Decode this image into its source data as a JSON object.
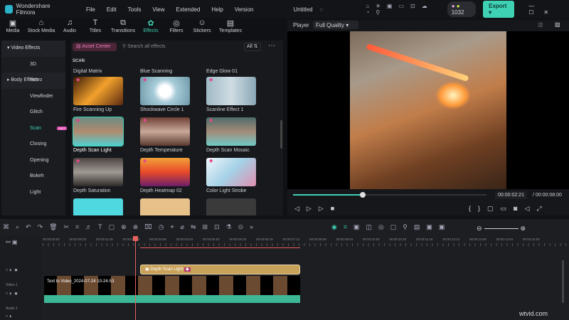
{
  "titlebar": {
    "app": "Wondershare Filmora",
    "menu": [
      "File",
      "Edit",
      "Tools",
      "View",
      "Extended",
      "Help",
      "Version"
    ],
    "project": "Untitled",
    "credits": "1032",
    "export": "Export"
  },
  "toolbar": [
    {
      "label": "Media",
      "icon": "▣"
    },
    {
      "label": "Stock Media",
      "icon": "⌂"
    },
    {
      "label": "Audio",
      "icon": "♫"
    },
    {
      "label": "Titles",
      "icon": "T"
    },
    {
      "label": "Transitions",
      "icon": "⧉"
    },
    {
      "label": "Effects",
      "icon": "✿"
    },
    {
      "label": "Filters",
      "icon": "◎"
    },
    {
      "label": "Stickers",
      "icon": "☺"
    },
    {
      "label": "Templates",
      "icon": "▤"
    }
  ],
  "sidebar": {
    "video_effects": "Video Effects",
    "items": [
      "3D",
      "Retro",
      "Viewfinder",
      "Glitch",
      "Scan",
      "Closing",
      "Opening",
      "Bokeh",
      "Light"
    ],
    "badge": "HOT",
    "body_effects": "Body Effects"
  },
  "effects": {
    "asset_center": "Asset Center",
    "search_placeholder": "Search all effects",
    "filter": "All",
    "section": "SCAN",
    "top_labels": [
      "Digital Matrix",
      "Blue Scanning",
      "Edge Glow 01"
    ],
    "items": [
      "Fire Scanning Up",
      "Shockwave Circle 1",
      "Scanline Effect 1",
      "Depth Scan Light",
      "Depth Temperature",
      "Depth Scan Mosaic",
      "Depth Saturation",
      "Depth Heatmap 02",
      "Color Light Strobe"
    ]
  },
  "player": {
    "tab": "Player",
    "quality": "Full Quality",
    "current": "00:00:02:21",
    "total": "/ 00:00:08:00",
    "progress": 0.36
  },
  "timeline": {
    "ruler": [
      "00:00:00:00",
      "00:00:00:20",
      "00:00:01:16",
      "00:00:02:12",
      "00:00:03:08",
      "00:00:04:04",
      "00:00:05:00",
      "00:00:05:20",
      "00:00:06:16",
      "00:00:07:12",
      "00:00:08:08",
      "00:00:09:04",
      "00:00:10:00",
      "00:00:10:20",
      "00:00:11:16",
      "00:00:12:12",
      "00:00:13:08",
      "00:00:14:04",
      "00:00:15:00"
    ],
    "effect_clip": "Depth Scan Light",
    "video_clip": "Text to Video_2024-07-24 10-24-53",
    "video_track": "Video 1",
    "audio_track": "Audio 1"
  },
  "watermark": "wtvid.com",
  "colors": {
    "accent": "#3fd1b4",
    "effect_clip": "#c9a25a",
    "playhead": "#e8615f",
    "audio": "#3cb897"
  }
}
